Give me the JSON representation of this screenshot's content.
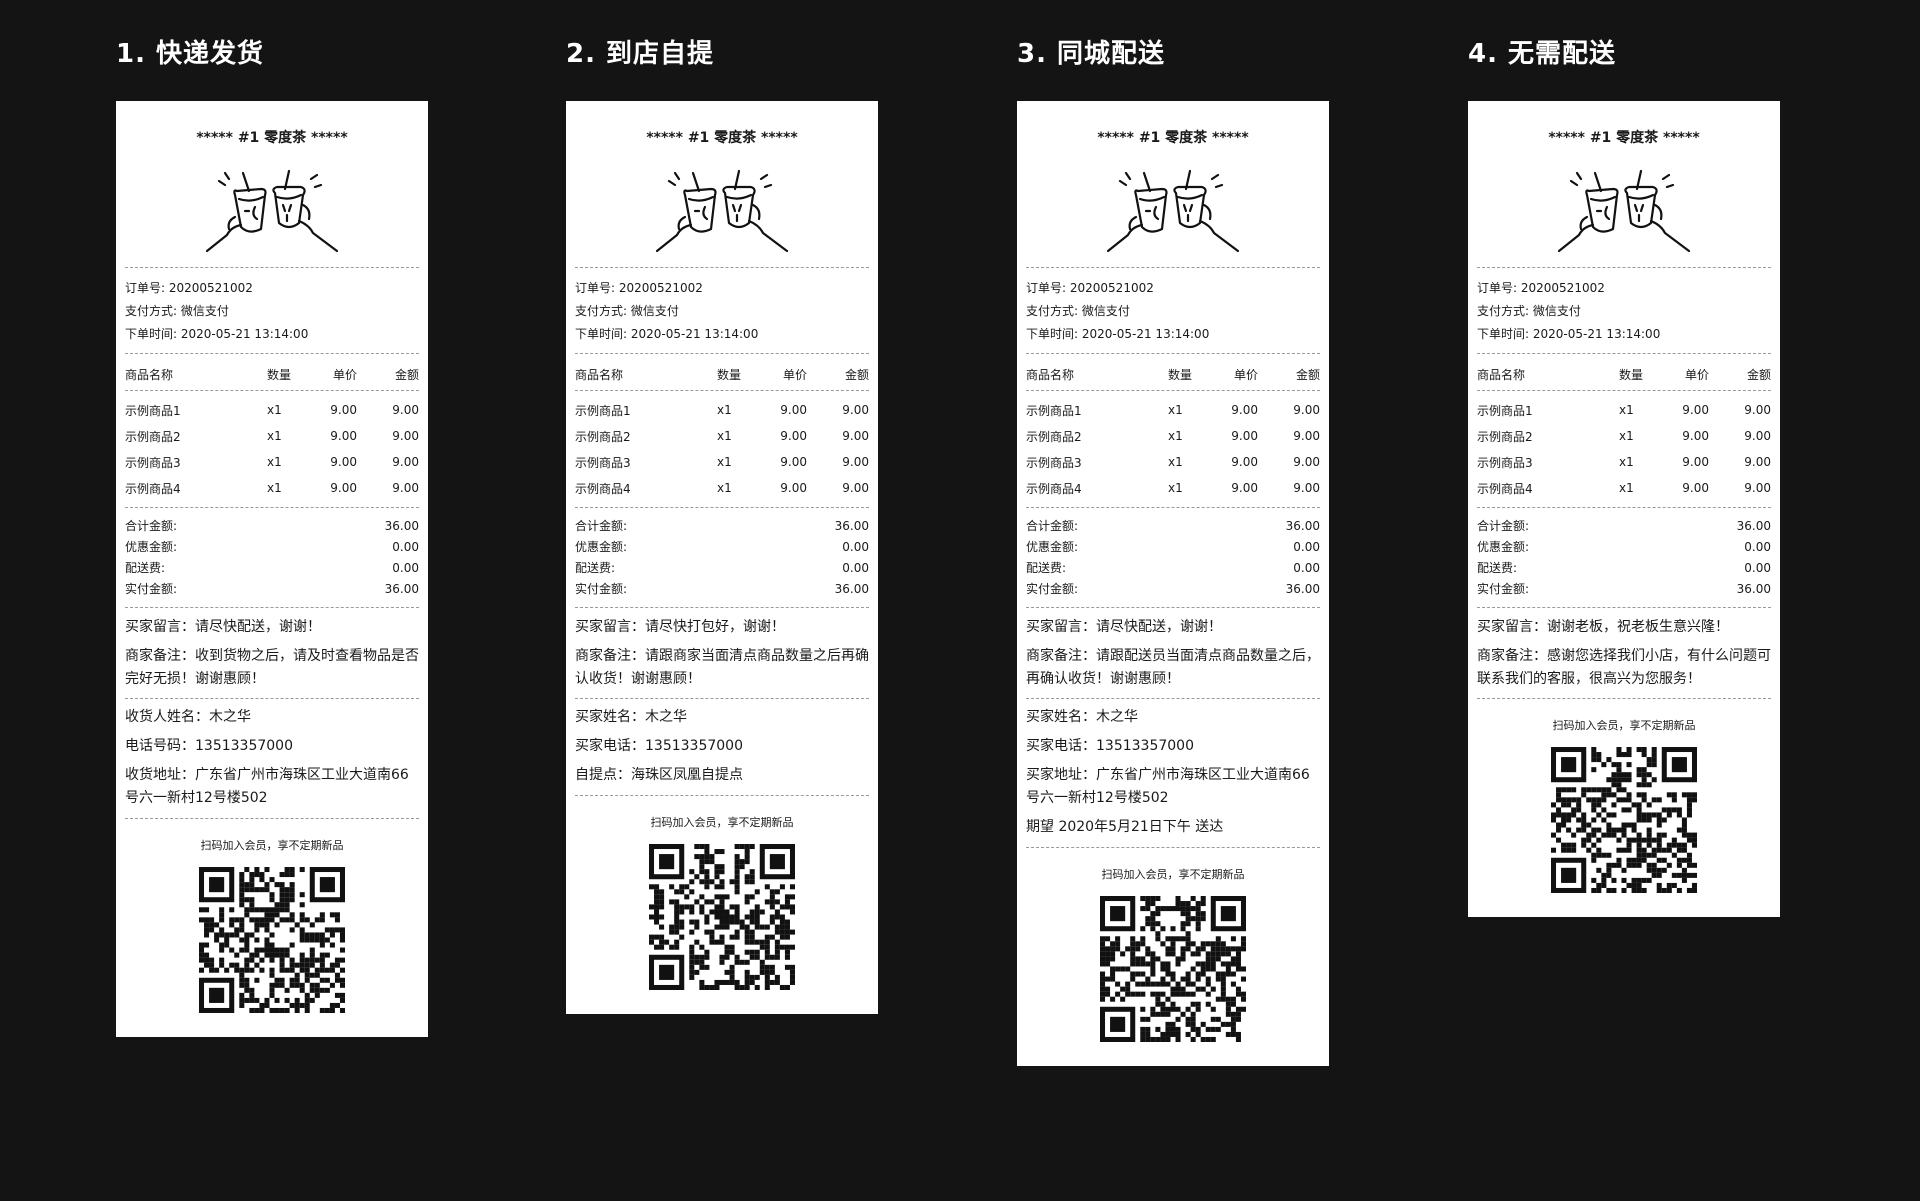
{
  "shop": "***** #1 零度茶 *****",
  "labels": {
    "order_no": "订单号:",
    "pay_method": "支付方式:",
    "order_time": "下单时间:",
    "col_name": "商品名称",
    "col_qty": "数量",
    "col_price": "单价",
    "col_amount": "金额",
    "total": "合计金额:",
    "discount": "优惠金额:",
    "delivery_fee": "配送费:",
    "paid": "实付金额:"
  },
  "order": {
    "number": "20200521002",
    "pay_method": "微信支付",
    "time": "2020-05-21 13:14:00"
  },
  "items": [
    {
      "name": "示例商品1",
      "qty": "x1",
      "price": "9.00",
      "amount": "9.00"
    },
    {
      "name": "示例商品2",
      "qty": "x1",
      "price": "9.00",
      "amount": "9.00"
    },
    {
      "name": "示例商品3",
      "qty": "x1",
      "price": "9.00",
      "amount": "9.00"
    },
    {
      "name": "示例商品4",
      "qty": "x1",
      "price": "9.00",
      "amount": "9.00"
    }
  ],
  "totals": {
    "total": "36.00",
    "discount": "0.00",
    "delivery_fee": "0.00",
    "paid": "36.00"
  },
  "qr_caption": "扫码加入会员，享不定期新品",
  "receipts": [
    {
      "title": "1. 快递发货",
      "buyer_note": "买家留言：请尽快配送，谢谢！",
      "merchant_note": "商家备注：收到货物之后，请及时查看物品是否完好无损！谢谢惠顾！",
      "lines": [
        "收货人姓名：木之华",
        "电话号码：13513357000",
        "收货地址：广东省广州市海珠区工业大道南66号六一新村12号楼502"
      ]
    },
    {
      "title": "2. 到店自提",
      "buyer_note": "买家留言：请尽快打包好，谢谢！",
      "merchant_note": "商家备注：请跟商家当面清点商品数量之后再确认收货！谢谢惠顾！",
      "lines": [
        "买家姓名：木之华",
        "买家电话：13513357000",
        "自提点：海珠区凤凰自提点"
      ]
    },
    {
      "title": "3. 同城配送",
      "buyer_note": "买家留言：请尽快配送，谢谢！",
      "merchant_note": "商家备注：请跟配送员当面清点商品数量之后，再确认收货！谢谢惠顾！",
      "lines": [
        "买家姓名：木之华",
        "买家电话：13513357000",
        "买家地址：广东省广州市海珠区工业大道南66号六一新村12号楼502",
        "期望 2020年5月21日下午 送达"
      ]
    },
    {
      "title": "4. 无需配送",
      "buyer_note": "买家留言：谢谢老板，祝老板生意兴隆！",
      "merchant_note": "商家备注：感谢您选择我们小店，有什么问题可联系我们的客服，很高兴为您服务！",
      "lines": []
    }
  ]
}
